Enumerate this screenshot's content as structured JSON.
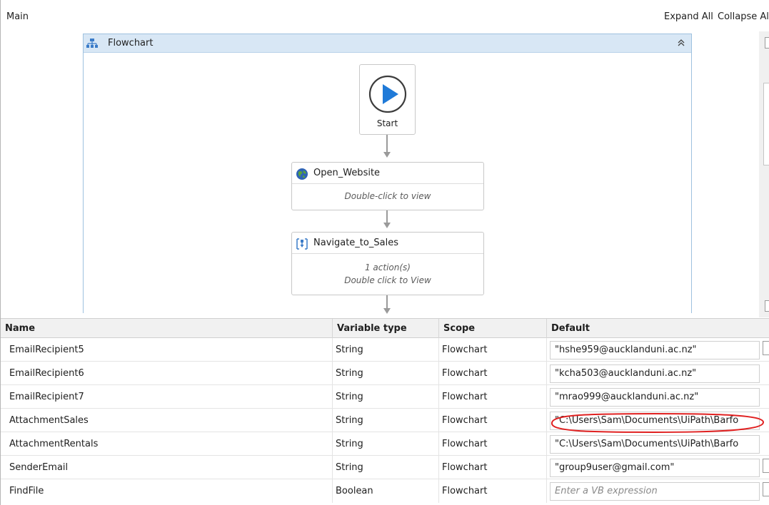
{
  "header": {
    "title": "Main",
    "expand_all": "Expand All",
    "collapse_all": "Collapse All"
  },
  "flowchart": {
    "title": "Flowchart",
    "start_label": "Start",
    "activities": [
      {
        "title": "Open_Website",
        "hint_line1": "Double-click to view",
        "hint_line2": ""
      },
      {
        "title": "Navigate_to_Sales",
        "hint_line1": "1 action(s)",
        "hint_line2": "Double click to View"
      }
    ]
  },
  "variables": {
    "columns": {
      "name": "Name",
      "type": "Variable type",
      "scope": "Scope",
      "default": "Default"
    },
    "rows": [
      {
        "name": "EmailRecipient5",
        "type": "String",
        "scope": "Flowchart",
        "default": "\"hshe959@aucklanduni.ac.nz\""
      },
      {
        "name": "EmailRecipient6",
        "type": "String",
        "scope": "Flowchart",
        "default": "\"kcha503@aucklanduni.ac.nz\""
      },
      {
        "name": "EmailRecipient7",
        "type": "String",
        "scope": "Flowchart",
        "default": "\"mrao999@aucklanduni.ac.nz\""
      },
      {
        "name": "AttachmentSales",
        "type": "String",
        "scope": "Flowchart",
        "default": "\"C:\\Users\\Sam\\Documents\\UiPath\\Barfo"
      },
      {
        "name": "AttachmentRentals",
        "type": "String",
        "scope": "Flowchart",
        "default": "\"C:\\Users\\Sam\\Documents\\UiPath\\Barfo"
      },
      {
        "name": "SenderEmail",
        "type": "String",
        "scope": "Flowchart",
        "default": "\"group9user@gmail.com\""
      },
      {
        "name": "FindFile",
        "type": "Boolean",
        "scope": "Flowchart",
        "default": "",
        "placeholder": "Enter a VB expression"
      }
    ]
  },
  "colors": {
    "flowchart_header": "#d8e7f5",
    "play_blue": "#1f7ad8",
    "annotation_red": "#e02020"
  },
  "icons": {
    "flowchart": "flowchart-icon",
    "collapse": "double-chevron-up-icon",
    "start": "play-circle-icon",
    "open_website": "globe-icon",
    "navigate": "sequence-icon"
  }
}
